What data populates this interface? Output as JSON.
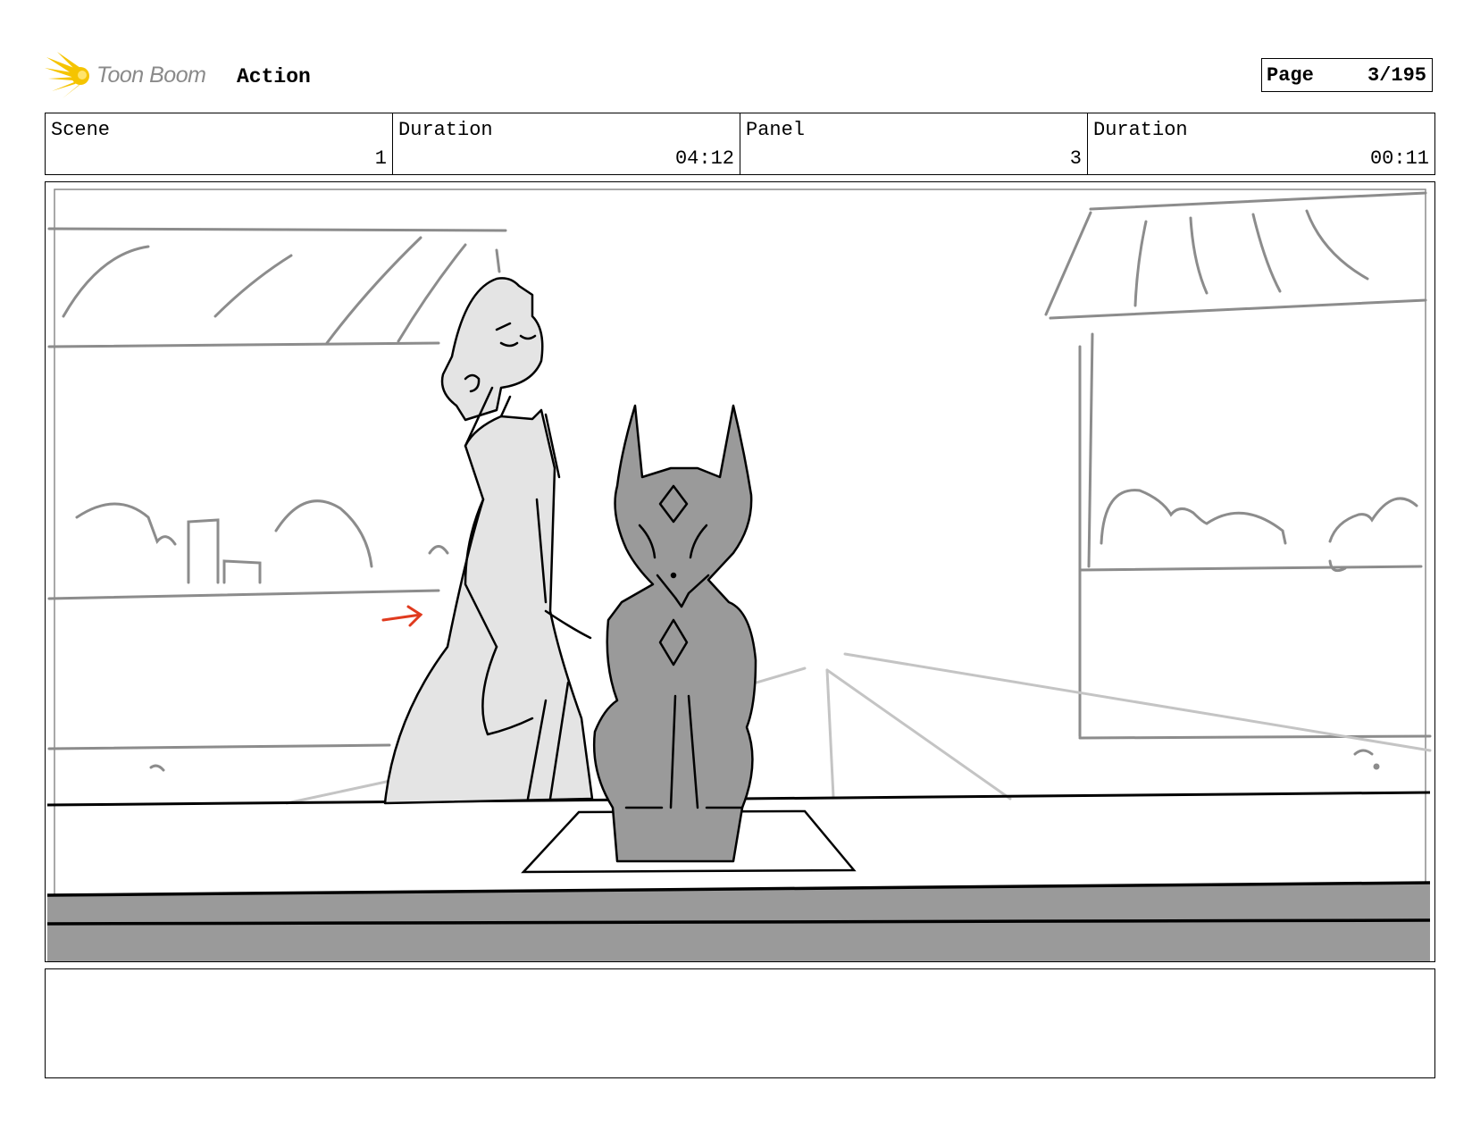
{
  "header": {
    "brand": "Toon Boom",
    "section": "Action",
    "page_label": "Page",
    "page_value": "3/195"
  },
  "info": {
    "scene_label": "Scene",
    "scene_value": "1",
    "scene_duration_label": "Duration",
    "scene_duration_value": "04:12",
    "panel_label": "Panel",
    "panel_value": "3",
    "panel_duration_label": "Duration",
    "panel_duration_value": "00:11"
  },
  "colors": {
    "logo_yellow": "#f5c400",
    "sketch_gray": "#8c8c8c",
    "cat_fill": "#9a9a9a",
    "coat_fill": "#e4e4e4",
    "arrow_red": "#e03a1e"
  },
  "notes": {
    "text": ""
  }
}
